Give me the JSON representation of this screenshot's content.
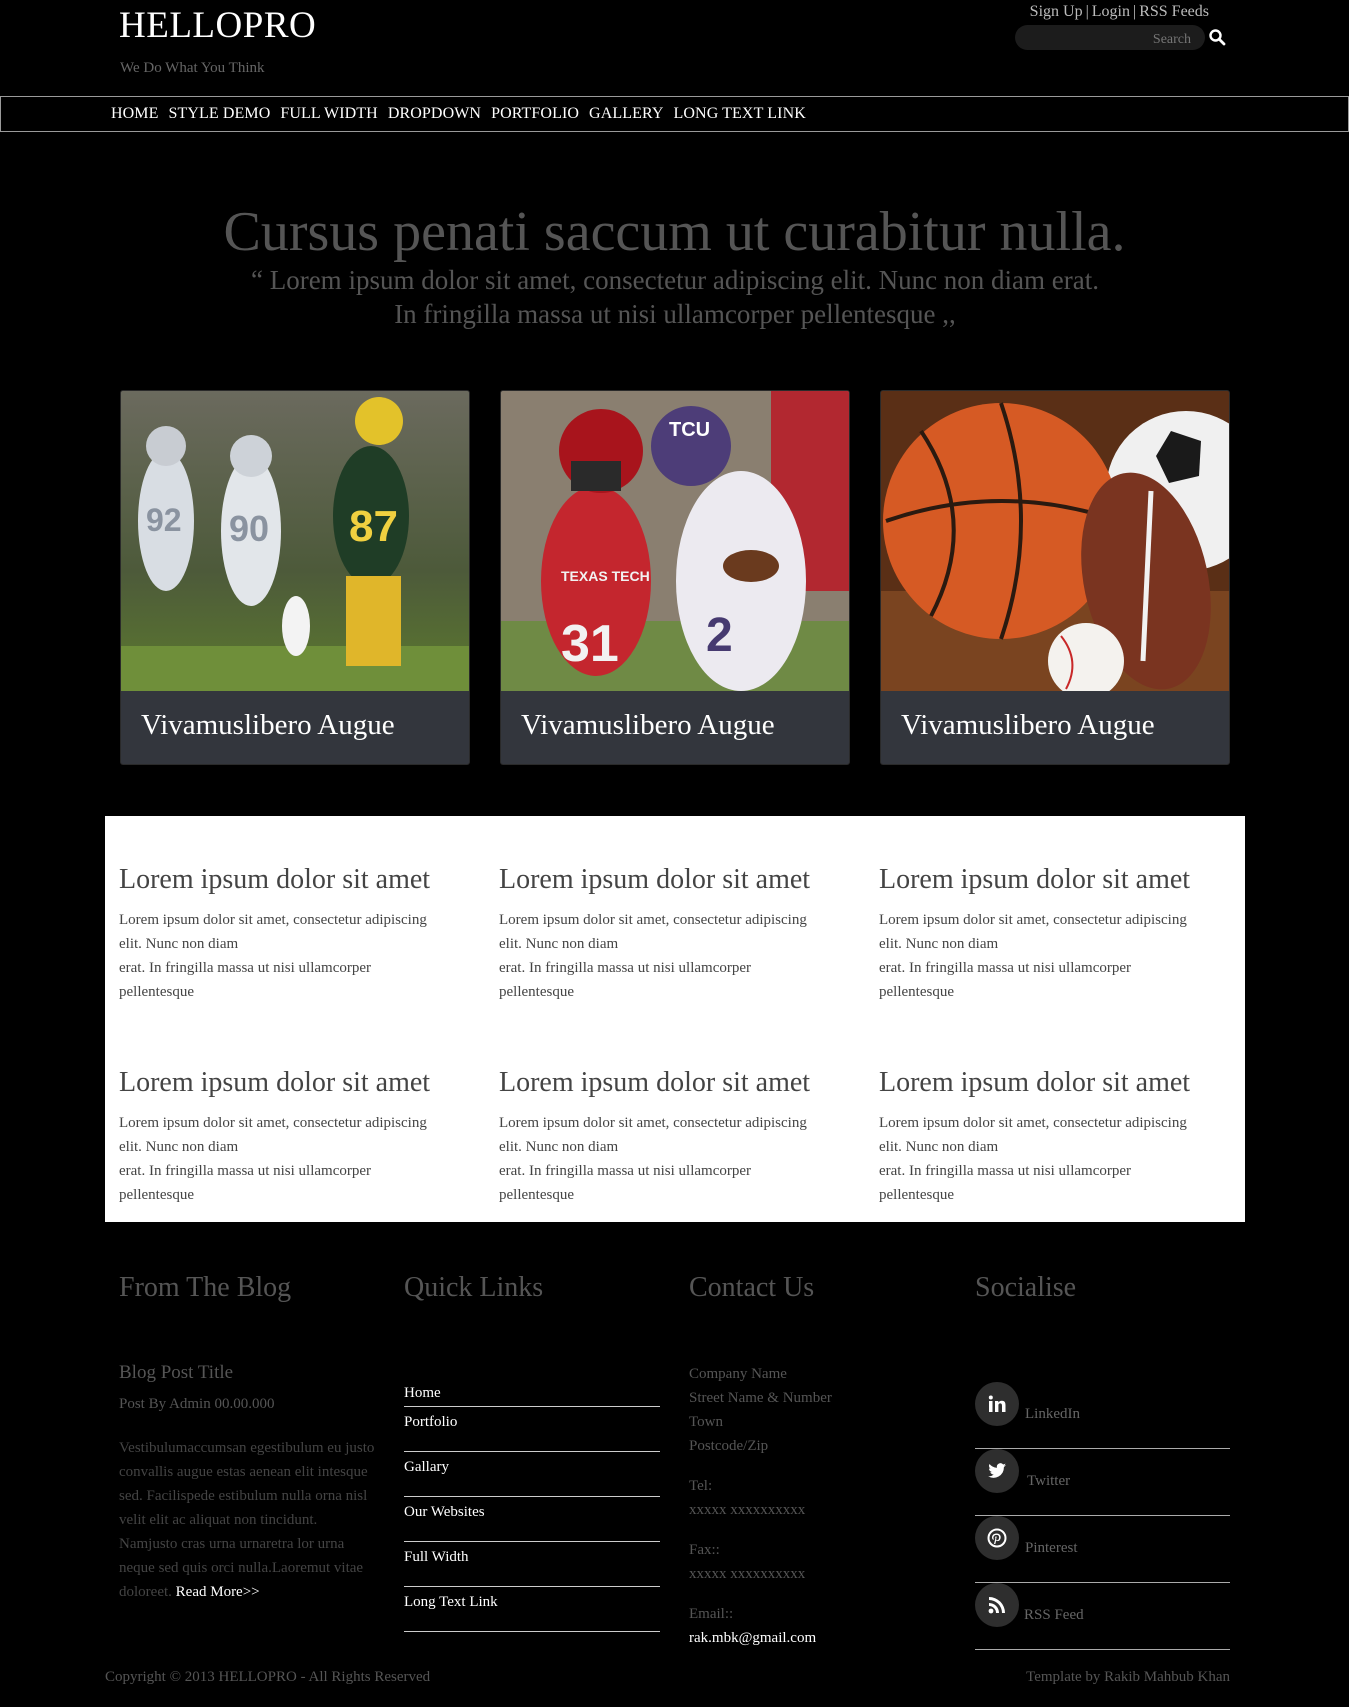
{
  "header": {
    "logo": "HELLOPRO",
    "tagline": "We Do What You Think",
    "toplinks": [
      "Sign Up",
      "Login",
      "RSS Feeds"
    ],
    "search_placeholder": "Search"
  },
  "nav": [
    "HOME",
    "STYLE DEMO",
    "FULL WIDTH",
    "DROPDOWN",
    "PORTFOLIO",
    "GALLERY",
    "LONG TEXT LINK"
  ],
  "hero": {
    "title": "Cursus penati saccum ut curabitur nulla.",
    "quote": "“ Lorem ipsum dolor sit amet, consectetur adipiscing elit. Nunc non diam erat. In fringilla massa ut nisi ullamcorper pellentesque ,,"
  },
  "cards": [
    {
      "caption": "Vivamuslibero Augue",
      "image": "american-football-players-running"
    },
    {
      "caption": "Vivamuslibero Augue",
      "image": "football-players-tackle"
    },
    {
      "caption": "Vivamuslibero Augue",
      "image": "sports-balls"
    }
  ],
  "features": [
    {
      "title": "Lorem ipsum dolor sit amet",
      "l1": "Lorem ipsum dolor sit amet, consectetur adipiscing",
      "l2": "elit. Nunc non diam",
      "l3": "erat. In fringilla massa ut nisi ullamcorper",
      "l4": "pellentesque"
    },
    {
      "title": "Lorem ipsum dolor sit amet",
      "l1": "Lorem ipsum dolor sit amet, consectetur adipiscing",
      "l2": "elit. Nunc non diam",
      "l3": "erat. In fringilla massa ut nisi ullamcorper",
      "l4": "pellentesque"
    },
    {
      "title": "Lorem ipsum dolor sit amet",
      "l1": "Lorem ipsum dolor sit amet, consectetur adipiscing",
      "l2": "elit. Nunc non diam",
      "l3": "erat. In fringilla massa ut nisi ullamcorper",
      "l4": "pellentesque"
    },
    {
      "title": "Lorem ipsum dolor sit amet",
      "l1": "Lorem ipsum dolor sit amet, consectetur adipiscing",
      "l2": "elit. Nunc non diam",
      "l3": "erat. In fringilla massa ut nisi ullamcorper",
      "l4": "pellentesque"
    },
    {
      "title": "Lorem ipsum dolor sit amet",
      "l1": "Lorem ipsum dolor sit amet, consectetur adipiscing",
      "l2": "elit. Nunc non diam",
      "l3": "erat. In fringilla massa ut nisi ullamcorper",
      "l4": "pellentesque"
    },
    {
      "title": "Lorem ipsum dolor sit amet",
      "l1": "Lorem ipsum dolor sit amet, consectetur adipiscing",
      "l2": "elit. Nunc non diam",
      "l3": "erat. In fringilla massa ut nisi ullamcorper",
      "l4": "pellentesque"
    }
  ],
  "footer": {
    "headings": [
      "From The Blog",
      "Quick Links",
      "Contact Us",
      "Socialise"
    ],
    "blog": {
      "title": "Blog Post Title",
      "meta": "Post By Admin 00.00.000",
      "body": "Vestibulumaccumsan egestibulum eu justo convallis augue estas aenean elit intesque sed. Facilispede estibulum nulla orna nisl velit elit ac aliquat non tincidunt. Namjusto cras urna urnaretra lor urna neque sed quis orci nulla.Laoremut vitae doloreet.",
      "read_more": "Read More>>"
    },
    "quick_links": [
      "Home",
      "Portfolio",
      "Gallary",
      "Our Websites",
      "Full Width",
      "Long Text Link"
    ],
    "contact": {
      "company": "Company Name",
      "street": "Street Name & Number",
      "town": "Town",
      "postcode": "Postcode/Zip",
      "tel_label": "Tel:",
      "tel": "xxxxx xxxxxxxxxx",
      "fax_label": "Fax::",
      "fax": "xxxxx xxxxxxxxxx",
      "email_label": "Email::",
      "email": "rak.mbk@gmail.com"
    },
    "social": [
      {
        "label": "LinkedIn",
        "icon": "linkedin-icon"
      },
      {
        "label": "Twitter",
        "icon": "twitter-icon"
      },
      {
        "label": "Pinterest",
        "icon": "pinterest-icon"
      },
      {
        "label": "RSS Feed",
        "icon": "rss-icon"
      }
    ],
    "copyright": "Copyright © 2013 HELLOPRO - All Rights Reserved",
    "credit": "Template by Rakib Mahbub Khan"
  }
}
